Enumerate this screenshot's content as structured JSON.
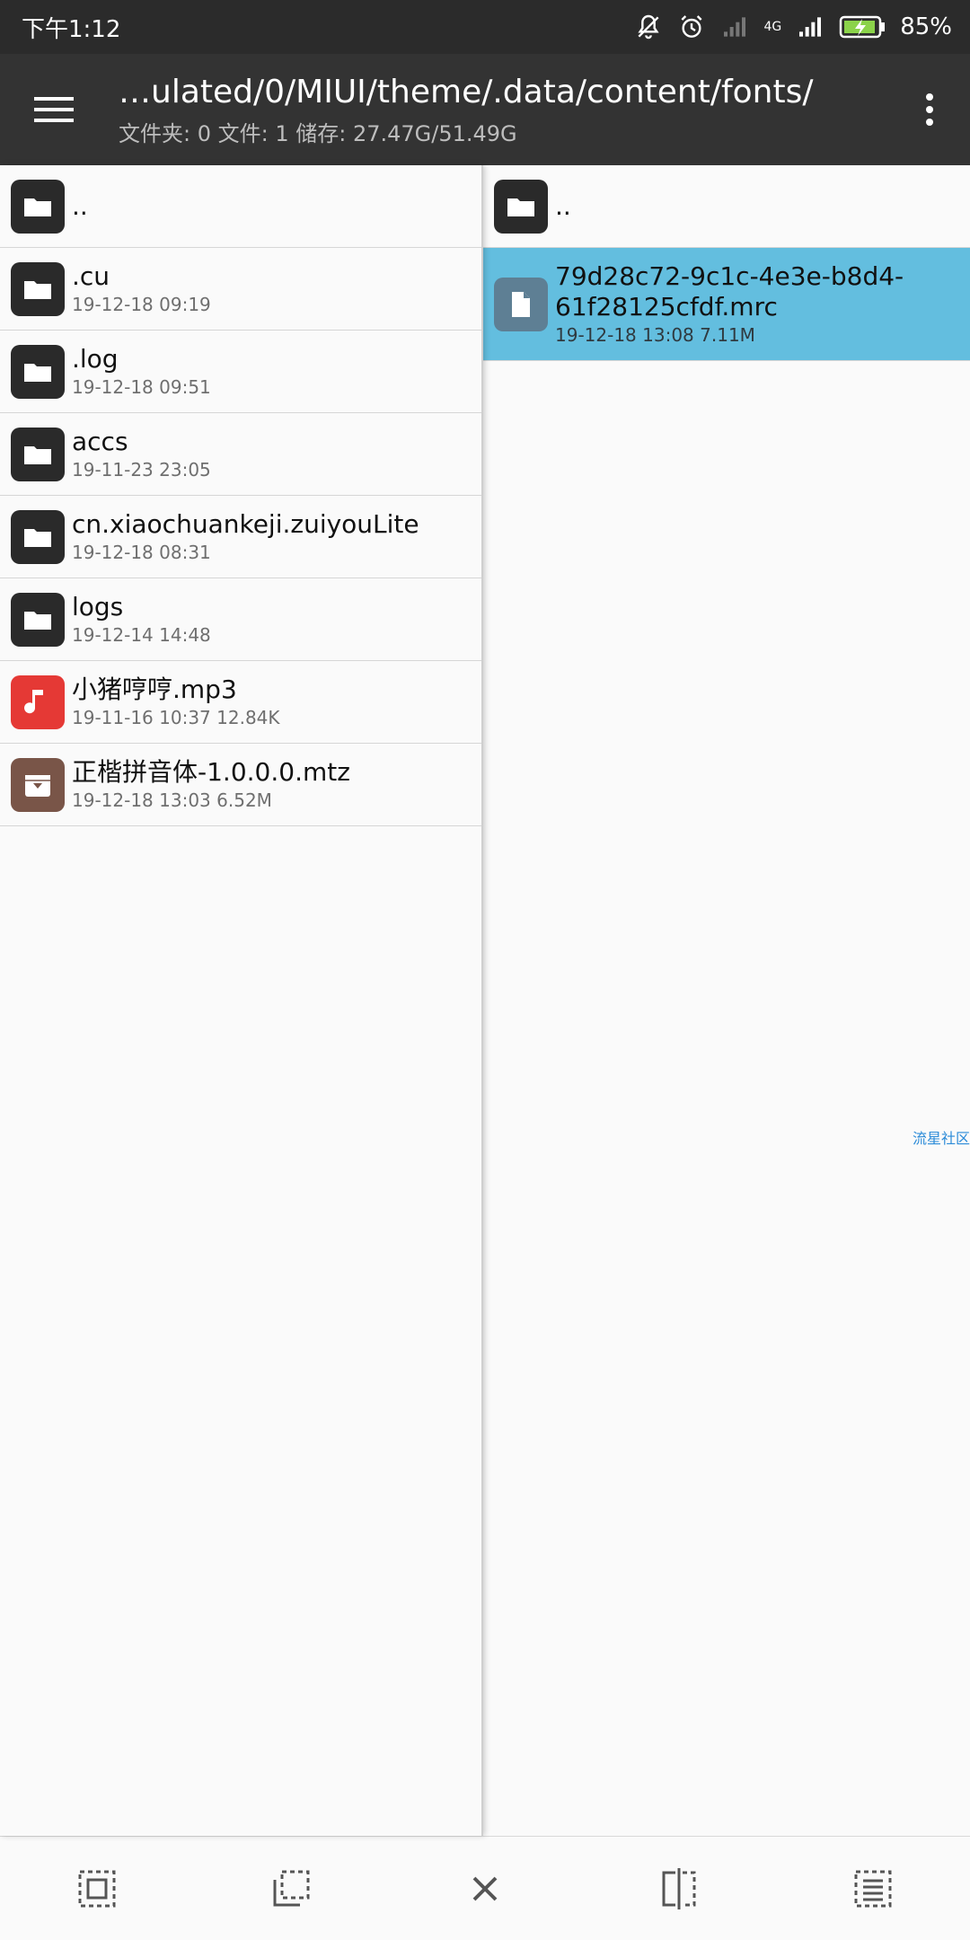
{
  "status_bar": {
    "time": "下午1:12",
    "network": "4G",
    "battery": "85%"
  },
  "appbar": {
    "path": "…ulated/0/MIUI/theme/.data/content/fonts/",
    "summary": "文件夹: 0  文件: 1  储存: 27.47G/51.49G"
  },
  "left_pane": {
    "parent": "..",
    "items": [
      {
        "name": ".cu",
        "meta": "19-12-18 09:19",
        "type": "folder"
      },
      {
        "name": ".log",
        "meta": "19-12-18 09:51",
        "type": "folder"
      },
      {
        "name": "accs",
        "meta": "19-11-23 23:05",
        "type": "folder"
      },
      {
        "name": "cn.xiaochuankeji.zuiyouLite",
        "meta": "19-12-18 08:31",
        "type": "folder"
      },
      {
        "name": "logs",
        "meta": "19-12-14 14:48",
        "type": "folder"
      },
      {
        "name": "小猪哼哼.mp3",
        "meta": "19-11-16 10:37  12.84K",
        "type": "audio"
      },
      {
        "name": "正楷拼音体-1.0.0.0.mtz",
        "meta": "19-12-18 13:03  6.52M",
        "type": "archive"
      }
    ]
  },
  "right_pane": {
    "parent": "..",
    "items": [
      {
        "name": "79d28c72-9c1c-4e3e-b8d4-61f28125cfdf.mrc",
        "meta": "19-12-18 13:08  7.11M",
        "type": "file",
        "selected": true
      }
    ]
  },
  "watermark": "流星社区",
  "colors": {
    "status_bar": "#2b2b2b",
    "app_bar": "#333333",
    "selected_row": "#63bedf",
    "folder_icon": "#2a2a2a",
    "audio_icon": "#e53935",
    "archive_icon": "#795548",
    "file_icon": "#5e7f94"
  },
  "bottom_bar": {
    "buttons": [
      "select-all-icon",
      "select-partial-icon",
      "close-icon",
      "compare-panes-icon",
      "list-select-icon"
    ]
  }
}
